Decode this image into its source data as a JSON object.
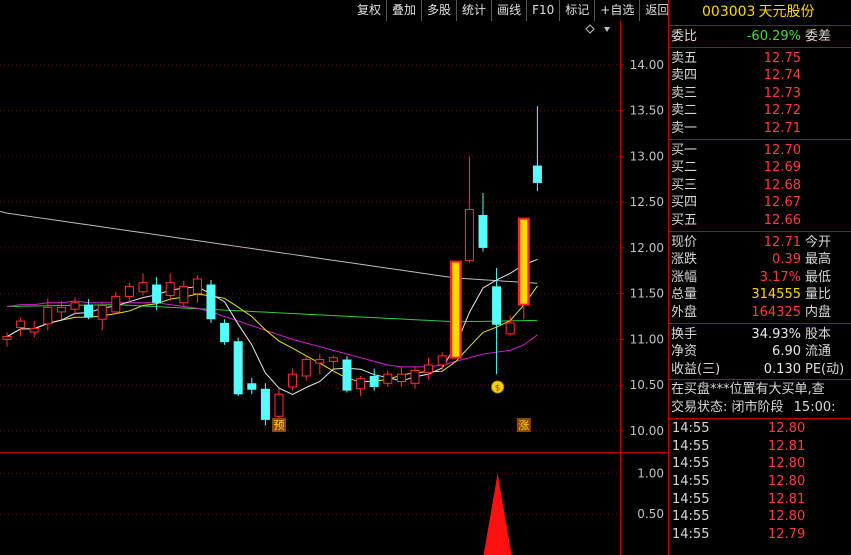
{
  "toolbar": [
    "复权",
    "叠加",
    "多股",
    "统计",
    "画线",
    "F10",
    "标记",
    "+自选",
    "返回"
  ],
  "stock": {
    "code": "003003",
    "name": "天元股份"
  },
  "weibi": {
    "label": "委比",
    "value": "-60.29%",
    "right_label": "委差"
  },
  "asks": [
    {
      "label": "卖五",
      "price": "12.75"
    },
    {
      "label": "卖四",
      "price": "12.74"
    },
    {
      "label": "卖三",
      "price": "12.73"
    },
    {
      "label": "卖二",
      "price": "12.72"
    },
    {
      "label": "卖一",
      "price": "12.71"
    }
  ],
  "bids": [
    {
      "label": "买一",
      "price": "12.70"
    },
    {
      "label": "买二",
      "price": "12.69"
    },
    {
      "label": "买三",
      "price": "12.68"
    },
    {
      "label": "买四",
      "price": "12.67"
    },
    {
      "label": "买五",
      "price": "12.66"
    }
  ],
  "quote": [
    {
      "label": "现价",
      "value": "12.71",
      "right": "今开"
    },
    {
      "label": "涨跌",
      "value": "0.39",
      "right": "最高"
    },
    {
      "label": "涨幅",
      "value": "3.17%",
      "right": "最低"
    },
    {
      "label": "总量",
      "value": "314555",
      "right": "量比"
    },
    {
      "label": "外盘",
      "value": "164325",
      "right": "内盘"
    }
  ],
  "stats": [
    {
      "label": "换手",
      "value": "34.93%",
      "right": "股本"
    },
    {
      "label": "净资",
      "value": "6.90",
      "right": "流通"
    },
    {
      "label": "收益(三)",
      "value": "0.130",
      "right": "PE(动)"
    }
  ],
  "info_lines": {
    "line1": "在买盘***位置有大买单,查",
    "line2_label": "交易状态: 闭市阶段",
    "line2_time": "15:00:"
  },
  "ticks": [
    {
      "time": "14:55",
      "price": "12.80"
    },
    {
      "time": "14:55",
      "price": "12.81"
    },
    {
      "time": "14:55",
      "price": "12.80"
    },
    {
      "time": "14:55",
      "price": "12.80"
    },
    {
      "time": "14:55",
      "price": "12.81"
    },
    {
      "time": "14:55",
      "price": "12.80"
    },
    {
      "time": "14:55",
      "price": "12.79"
    }
  ],
  "chart_data": {
    "type": "candlestick",
    "y_ticks": [
      "14.00",
      "13.50",
      "13.00",
      "12.50",
      "12.00",
      "11.50",
      "11.00",
      "10.50",
      "10.00"
    ],
    "ylim": [
      9.78,
      14.48
    ],
    "sub_y_ticks": [
      "1.00",
      "0.50"
    ],
    "sub_ylim": [
      0,
      1.25
    ],
    "markers": [
      {
        "index": 20,
        "text": "预"
      },
      {
        "index": 38,
        "text": "涨"
      }
    ],
    "money_bag_index": 36,
    "signal_index": 36,
    "signal_value": 1.0,
    "candles": [
      {
        "o": 11.0,
        "h": 11.08,
        "l": 10.92,
        "c": 11.03
      },
      {
        "o": 11.13,
        "h": 11.24,
        "l": 11.03,
        "c": 11.2
      },
      {
        "o": 11.08,
        "h": 11.2,
        "l": 11.02,
        "c": 11.12
      },
      {
        "o": 11.17,
        "h": 11.45,
        "l": 11.1,
        "c": 11.35
      },
      {
        "o": 11.3,
        "h": 11.42,
        "l": 11.22,
        "c": 11.35
      },
      {
        "o": 11.33,
        "h": 11.46,
        "l": 11.27,
        "c": 11.4
      },
      {
        "o": 11.38,
        "h": 11.44,
        "l": 11.22,
        "c": 11.24
      },
      {
        "o": 11.22,
        "h": 11.4,
        "l": 11.1,
        "c": 11.37
      },
      {
        "o": 11.3,
        "h": 11.52,
        "l": 11.28,
        "c": 11.47
      },
      {
        "o": 11.47,
        "h": 11.62,
        "l": 11.4,
        "c": 11.58
      },
      {
        "o": 11.52,
        "h": 11.72,
        "l": 11.48,
        "c": 11.62
      },
      {
        "o": 11.6,
        "h": 11.68,
        "l": 11.32,
        "c": 11.4
      },
      {
        "o": 11.48,
        "h": 11.72,
        "l": 11.42,
        "c": 11.62
      },
      {
        "o": 11.4,
        "h": 11.64,
        "l": 11.36,
        "c": 11.58
      },
      {
        "o": 11.5,
        "h": 11.7,
        "l": 11.4,
        "c": 11.66
      },
      {
        "o": 11.6,
        "h": 11.65,
        "l": 11.18,
        "c": 11.22
      },
      {
        "o": 11.18,
        "h": 11.22,
        "l": 10.94,
        "c": 10.97
      },
      {
        "o": 10.98,
        "h": 11.02,
        "l": 10.38,
        "c": 10.4
      },
      {
        "o": 10.52,
        "h": 10.58,
        "l": 10.4,
        "c": 10.45
      },
      {
        "o": 10.46,
        "h": 10.52,
        "l": 10.06,
        "c": 10.12
      },
      {
        "o": 10.16,
        "h": 10.46,
        "l": 10.14,
        "c": 10.4
      },
      {
        "o": 10.48,
        "h": 10.68,
        "l": 10.44,
        "c": 10.62
      },
      {
        "o": 10.6,
        "h": 10.82,
        "l": 10.55,
        "c": 10.78
      },
      {
        "o": 10.74,
        "h": 10.84,
        "l": 10.62,
        "c": 10.78
      },
      {
        "o": 10.76,
        "h": 10.82,
        "l": 10.68,
        "c": 10.8
      },
      {
        "o": 10.78,
        "h": 10.82,
        "l": 10.42,
        "c": 10.44
      },
      {
        "o": 10.46,
        "h": 10.6,
        "l": 10.38,
        "c": 10.57
      },
      {
        "o": 10.6,
        "h": 10.68,
        "l": 10.44,
        "c": 10.48
      },
      {
        "o": 10.52,
        "h": 10.66,
        "l": 10.48,
        "c": 10.62
      },
      {
        "o": 10.54,
        "h": 10.7,
        "l": 10.48,
        "c": 10.62
      },
      {
        "o": 10.52,
        "h": 10.7,
        "l": 10.46,
        "c": 10.66
      },
      {
        "o": 10.64,
        "h": 10.8,
        "l": 10.56,
        "c": 10.72
      },
      {
        "o": 10.72,
        "h": 10.86,
        "l": 10.66,
        "c": 10.82
      },
      {
        "o": 10.8,
        "h": 11.86,
        "l": 10.8,
        "c": 11.85
      },
      {
        "o": 11.86,
        "h": 13.0,
        "l": 11.84,
        "c": 12.42
      },
      {
        "o": 12.36,
        "h": 12.6,
        "l": 11.96,
        "c": 12.0
      },
      {
        "o": 11.58,
        "h": 11.78,
        "l": 10.62,
        "c": 11.16
      },
      {
        "o": 11.06,
        "h": 11.26,
        "l": 11.04,
        "c": 11.18
      },
      {
        "o": 11.38,
        "h": 12.32,
        "l": 11.22,
        "c": 12.32
      },
      {
        "o": 12.9,
        "h": 13.55,
        "l": 12.62,
        "c": 12.71
      }
    ],
    "limit_up_indices": [
      33,
      38
    ]
  }
}
